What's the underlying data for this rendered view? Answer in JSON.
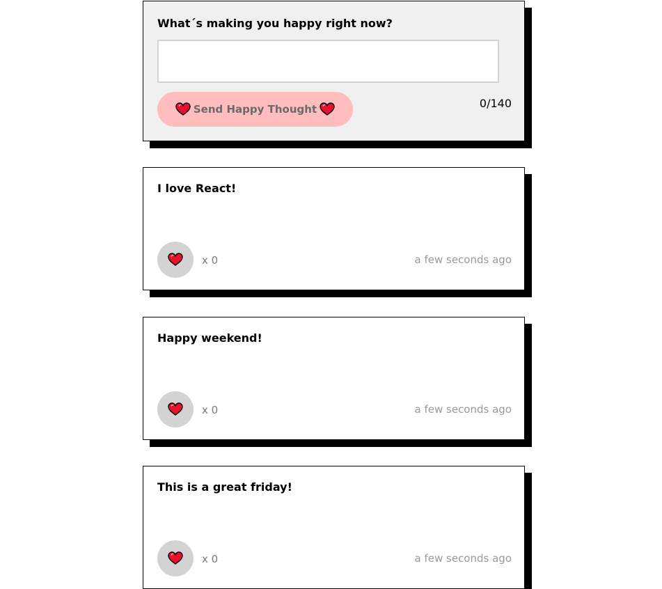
{
  "form": {
    "title": "What´s making you happy right now?",
    "input_value": "",
    "send_label": "Send Happy Thought",
    "char_count": "0/140"
  },
  "thoughts": [
    {
      "message": "I love React!",
      "likes": "x 0",
      "time": "a few seconds ago"
    },
    {
      "message": "Happy weekend!",
      "likes": "x 0",
      "time": "a few seconds ago"
    },
    {
      "message": "This is a great friday!",
      "likes": "x 0",
      "time": "a few seconds ago"
    }
  ],
  "icons": {
    "heart": "heart-icon"
  },
  "colors": {
    "heart_fill": "#e8112d",
    "button_pink": "#ffbdbd",
    "like_circle": "#d3d3d3",
    "form_bg": "#f0f0f0"
  }
}
